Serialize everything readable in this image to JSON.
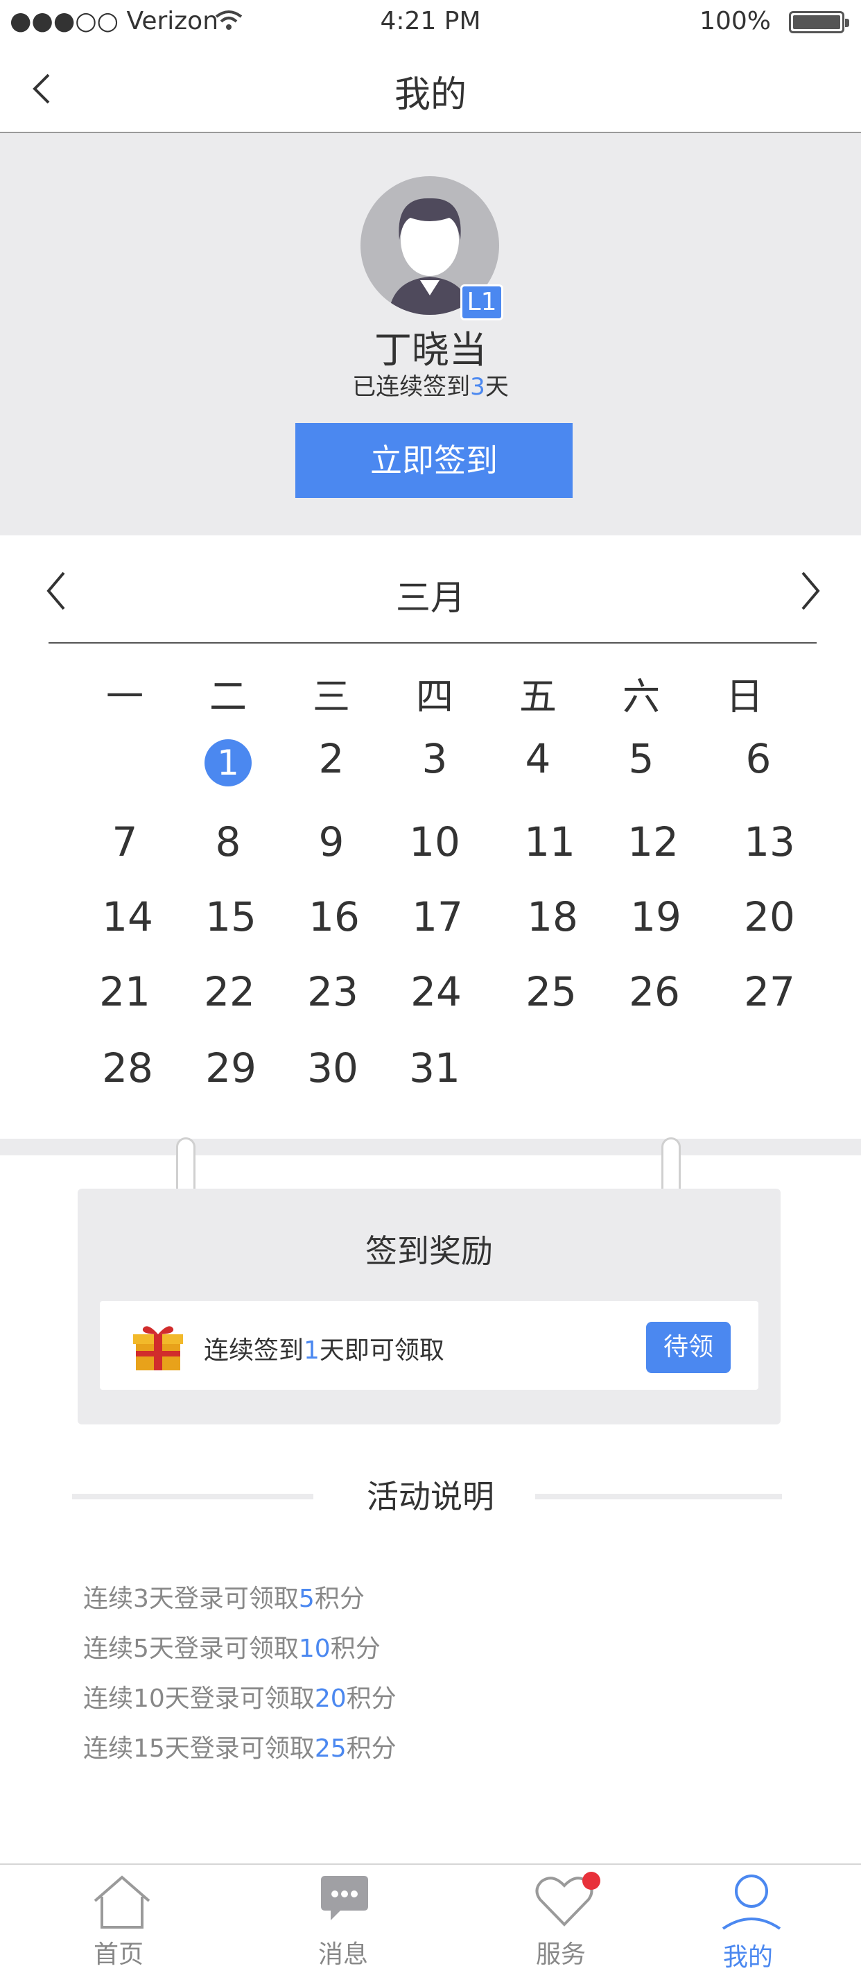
{
  "status_bar": {
    "carrier": "●●●○○ Verizon",
    "time": "4:21 PM",
    "battery": "100%"
  },
  "nav": {
    "title": "我的"
  },
  "profile": {
    "level_badge": "L1",
    "name": "丁晓当",
    "streak_prefix": "已连续签到",
    "streak_days": "3",
    "streak_suffix": "天",
    "sign_button": "立即签到"
  },
  "calendar": {
    "month": "三月",
    "weekdays": [
      "一",
      "二",
      "三",
      "四",
      "五",
      "六",
      "日"
    ],
    "today": "1",
    "days": [
      "1",
      "2",
      "3",
      "4",
      "5",
      "6",
      "7",
      "8",
      "9",
      "10",
      "11",
      "12",
      "13",
      "14",
      "15",
      "16",
      "17",
      "18",
      "19",
      "20",
      "21",
      "22",
      "23",
      "24",
      "25",
      "26",
      "27",
      "28",
      "29",
      "30",
      "31"
    ]
  },
  "reward": {
    "title": "签到奖励",
    "text_prefix": "连续签到",
    "text_days": "1",
    "text_suffix": "天即可领取",
    "button": "待领"
  },
  "rules": {
    "title": "活动说明",
    "items": [
      {
        "prefix": "连续3天登录可领取",
        "points": "5",
        "suffix": "积分"
      },
      {
        "prefix": "连续5天登录可领取",
        "points": "10",
        "suffix": "积分"
      },
      {
        "prefix": "连续10天登录可领取",
        "points": "20",
        "suffix": "积分"
      },
      {
        "prefix": "连续15天登录可领取",
        "points": "25",
        "suffix": "积分"
      }
    ]
  },
  "tabbar": {
    "items": [
      {
        "label": "首页",
        "icon": "home-icon"
      },
      {
        "label": "消息",
        "icon": "message-icon"
      },
      {
        "label": "服务",
        "icon": "heart-icon"
      },
      {
        "label": "我的",
        "icon": "user-icon"
      }
    ],
    "active": "我的"
  },
  "colors": {
    "accent": "#4b88f0",
    "badge_red": "#e8313a",
    "panel_gray": "#ebebed"
  }
}
